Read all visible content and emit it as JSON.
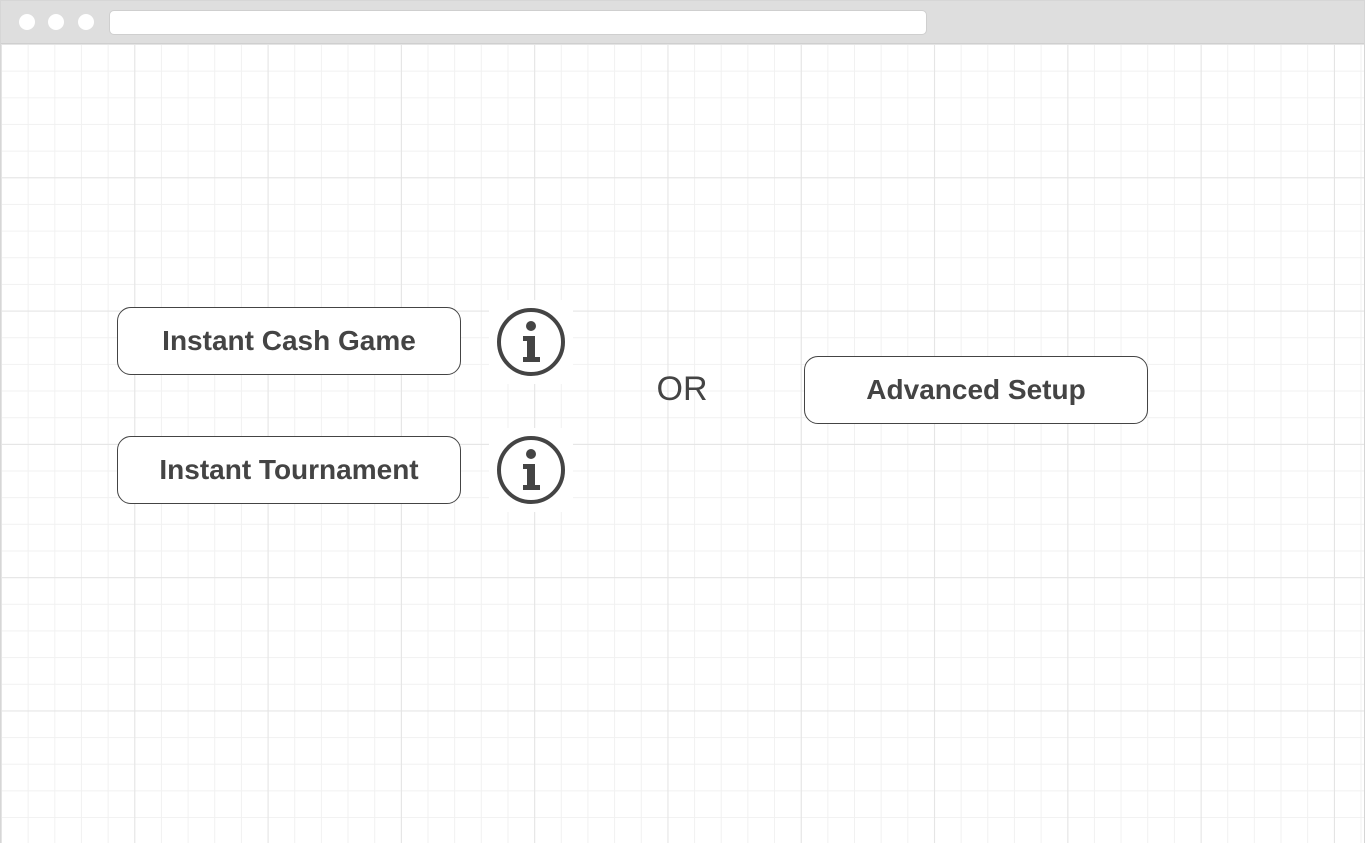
{
  "buttons": {
    "cash_game": "Instant Cash Game",
    "tournament": "Instant Tournament",
    "advanced": "Advanced Setup"
  },
  "separator": "OR",
  "icons": {
    "cash_info": "info-icon",
    "tournament_info": "info-icon"
  },
  "colors": {
    "text": "#444444",
    "border": "#444444",
    "chrome": "#dedede",
    "grid": "#e4e4e4"
  }
}
